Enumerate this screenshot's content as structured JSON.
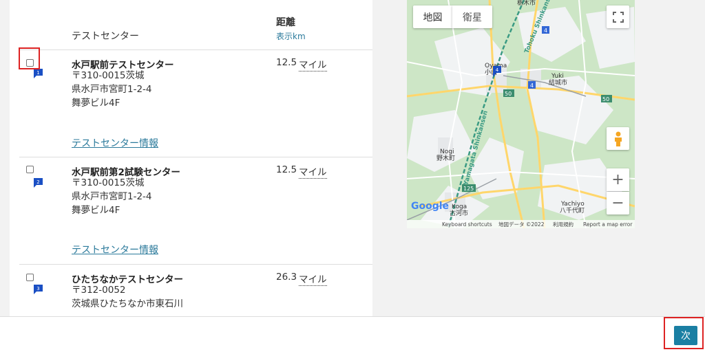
{
  "list": {
    "header_center": "テストセンター",
    "header_distance": "距離",
    "header_distance_unit": "表示km",
    "centers": [
      {
        "pin": "1",
        "name": "水戸駅前テストセンター",
        "addr1": "〒310-0015茨城",
        "addr2": "県水戸市宮町1-2-4",
        "addr3": "舞夢ビル4F",
        "distance": "12.5",
        "unit": "マイル",
        "link": "テストセンター情報"
      },
      {
        "pin": "2",
        "name": "水戸駅前第2試験センター",
        "addr1": "〒310-0015茨城",
        "addr2": "県水戸市宮町1-2-4",
        "addr3": "舞夢ビル4F",
        "distance": "12.5",
        "unit": "マイル",
        "link": "テストセンター情報"
      },
      {
        "pin": "3",
        "name": "ひたちなかテストセンター",
        "addr1": "〒312-0052",
        "addr2": "茨城県ひたちなか市東石川",
        "addr3": "",
        "distance": "26.3",
        "unit": "マイル",
        "link": ""
      }
    ]
  },
  "map": {
    "tab_map": "地図",
    "tab_satellite": "衛星",
    "zoom_in": "+",
    "zoom_out": "−",
    "labels": {
      "tochigi": "栃木市",
      "oyama_en": "Oyama",
      "oyama_jp": "小山",
      "yuki_en": "Yuki",
      "yuki_jp": "結城市",
      "nogi_en": "Nogi",
      "nogi_jp": "野木町",
      "koga_en": "Koga",
      "koga_jp": "古河市",
      "yachiyo_en": "Yachiyo",
      "yachiyo_jp": "八千代町",
      "tohoku": "Tohoku Shinkansen",
      "yamagata": "Yamagata Shinkansen",
      "route4": "4",
      "route50": "50",
      "route125": "125",
      "pin4": "4",
      "google": "Google",
      "shortcuts": "Keyboard shortcuts",
      "mapdata": "地図データ ©2022",
      "terms": "利用規約",
      "report": "Report a map error"
    }
  },
  "footer": {
    "next_label": "次"
  },
  "colors": {
    "accent": "#1a7fa3",
    "link": "#2b7a9b",
    "highlight": "#dd2222",
    "pin": "#1a4fc4"
  }
}
